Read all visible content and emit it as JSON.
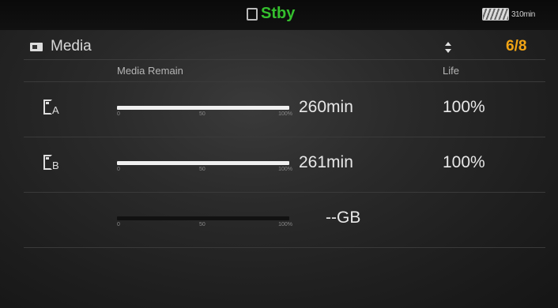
{
  "status": {
    "mode_label": "Stby",
    "battery_time": "310min",
    "mode_color": "#35c02e"
  },
  "header": {
    "title": "Media",
    "page": "6/8",
    "page_color": "#f2a414"
  },
  "columns": {
    "remain": "Media Remain",
    "life": "Life"
  },
  "gauge_ticks": [
    "0",
    "50",
    "100%"
  ],
  "slots": [
    {
      "letter": "A",
      "remain": "260min",
      "life": "100%",
      "fill_fraction": 1.0
    },
    {
      "letter": "B",
      "remain": "261min",
      "life": "100%",
      "fill_fraction": 1.0
    },
    {
      "letter": "",
      "remain": "--GB",
      "life": "",
      "fill_fraction": 0.0
    }
  ]
}
